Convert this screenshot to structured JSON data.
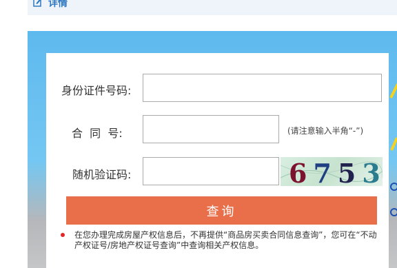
{
  "header": {
    "title": "详情",
    "icon": "edit-icon"
  },
  "form": {
    "id_label": "身份证件号码:",
    "id_value": "",
    "contract_label": "合  同  号:",
    "contract_value": "",
    "contract_hint": "(请注意输入半角“-”)",
    "captcha_label": "随机验证码:",
    "captcha_value": "",
    "captcha_digits": [
      "6",
      "7",
      "5",
      "3"
    ],
    "captcha_colors": [
      "#7a1230",
      "#1f3f82",
      "#22224f",
      "#2c7c90"
    ],
    "submit_label": "查询"
  },
  "notice": {
    "text": "在您办理完成房屋产权信息后，不再提供“商品房买卖合同信息查询”，您可在“不动产权证号/房地产权证号查询”中查询相关产权信息。"
  },
  "colors": {
    "accent": "#e86f49",
    "banner": "#5eb9ee",
    "title": "#2f77c0",
    "notice_dot": "#e3262a"
  }
}
